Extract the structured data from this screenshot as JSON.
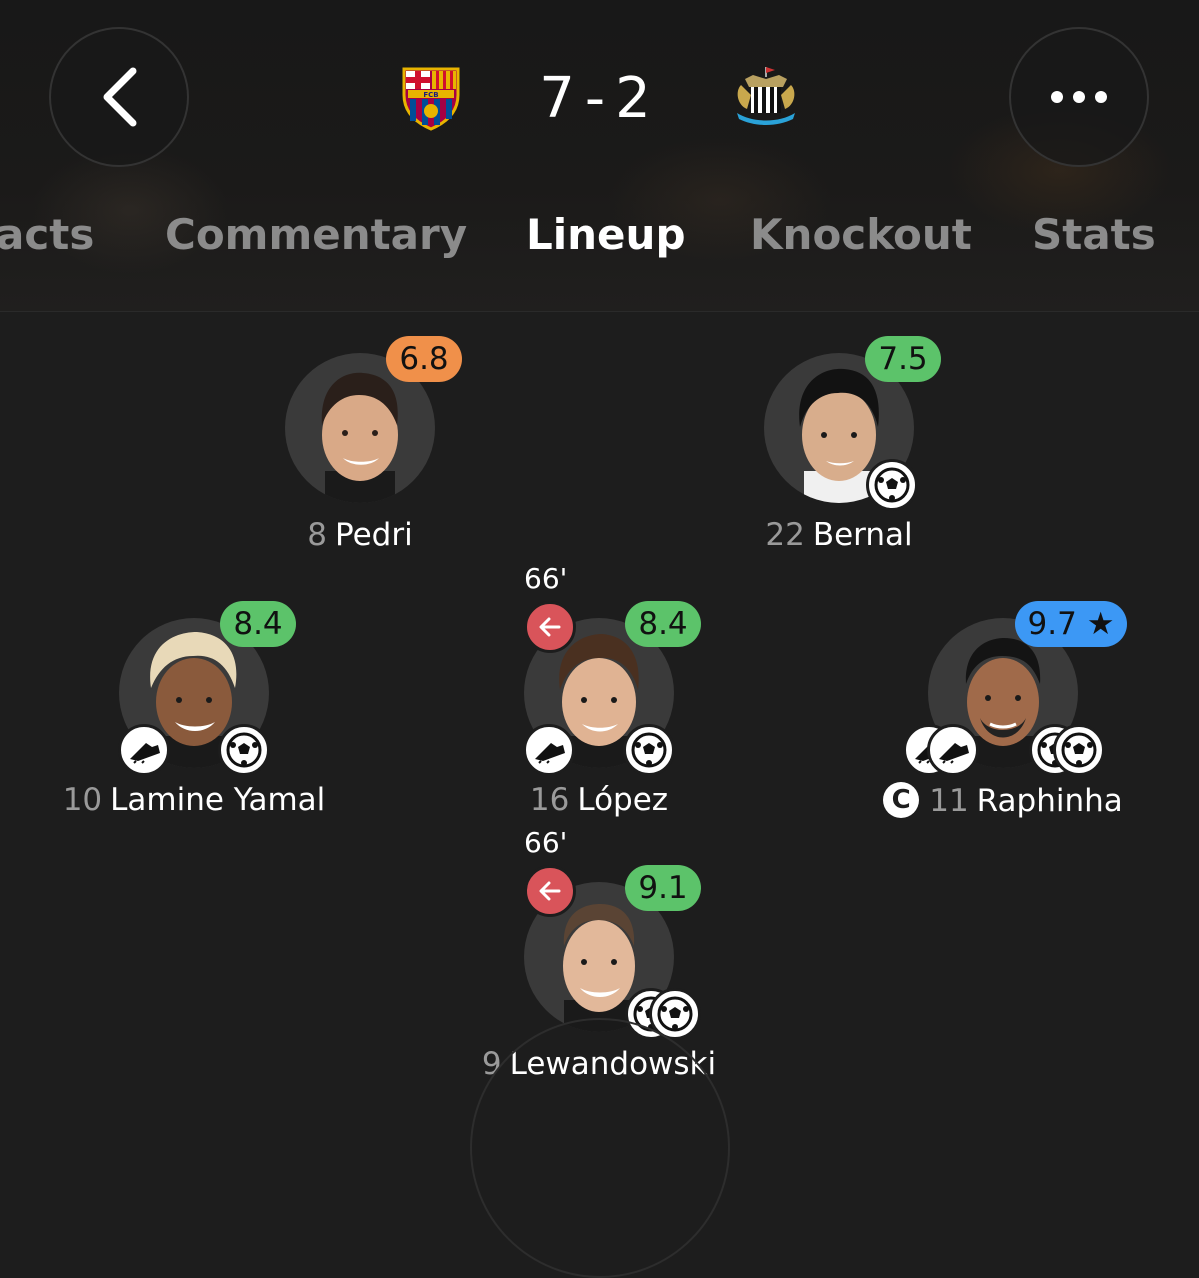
{
  "header": {
    "home_team": "FCB",
    "home_score": "7",
    "separator": "-",
    "away_score": "2",
    "colors": {
      "background": "#1d1d1d",
      "active_tab": "#ffffff",
      "inactive_tab": "#8b8b8b"
    }
  },
  "tabs": [
    {
      "label": "Facts"
    },
    {
      "label": "Commentary"
    },
    {
      "label": "Lineup",
      "active": true
    },
    {
      "label": "Knockout"
    },
    {
      "label": "Stats"
    }
  ],
  "tab_facts_visible": "acts",
  "players": {
    "pedri": {
      "number": "8",
      "name": "Pedri",
      "rating": "6.8",
      "rating_color": "#f0904a"
    },
    "bernal": {
      "number": "22",
      "name": "Bernal",
      "rating": "7.5",
      "rating_color": "#5cc36a",
      "goals": 1
    },
    "yamal": {
      "number": "10",
      "name": "Lamine Yamal",
      "rating": "8.4",
      "rating_color": "#5cc36a",
      "assists": 1,
      "goals": 1
    },
    "lopez": {
      "number": "16",
      "name": "López",
      "rating": "8.4",
      "rating_color": "#5cc36a",
      "sub_time": "66'",
      "assists": 1,
      "goals": 1
    },
    "raphinha": {
      "number": "11",
      "name": "Raphinha",
      "rating": "9.7",
      "rating_star": "★",
      "rating_color": "#3c98f5",
      "captain": "C",
      "assists": 2,
      "goals": 2
    },
    "lewandowski": {
      "number": "9",
      "name": "Lewandowski",
      "rating": "9.1",
      "rating_color": "#5cc36a",
      "sub_time": "66'",
      "goals": 2
    }
  }
}
